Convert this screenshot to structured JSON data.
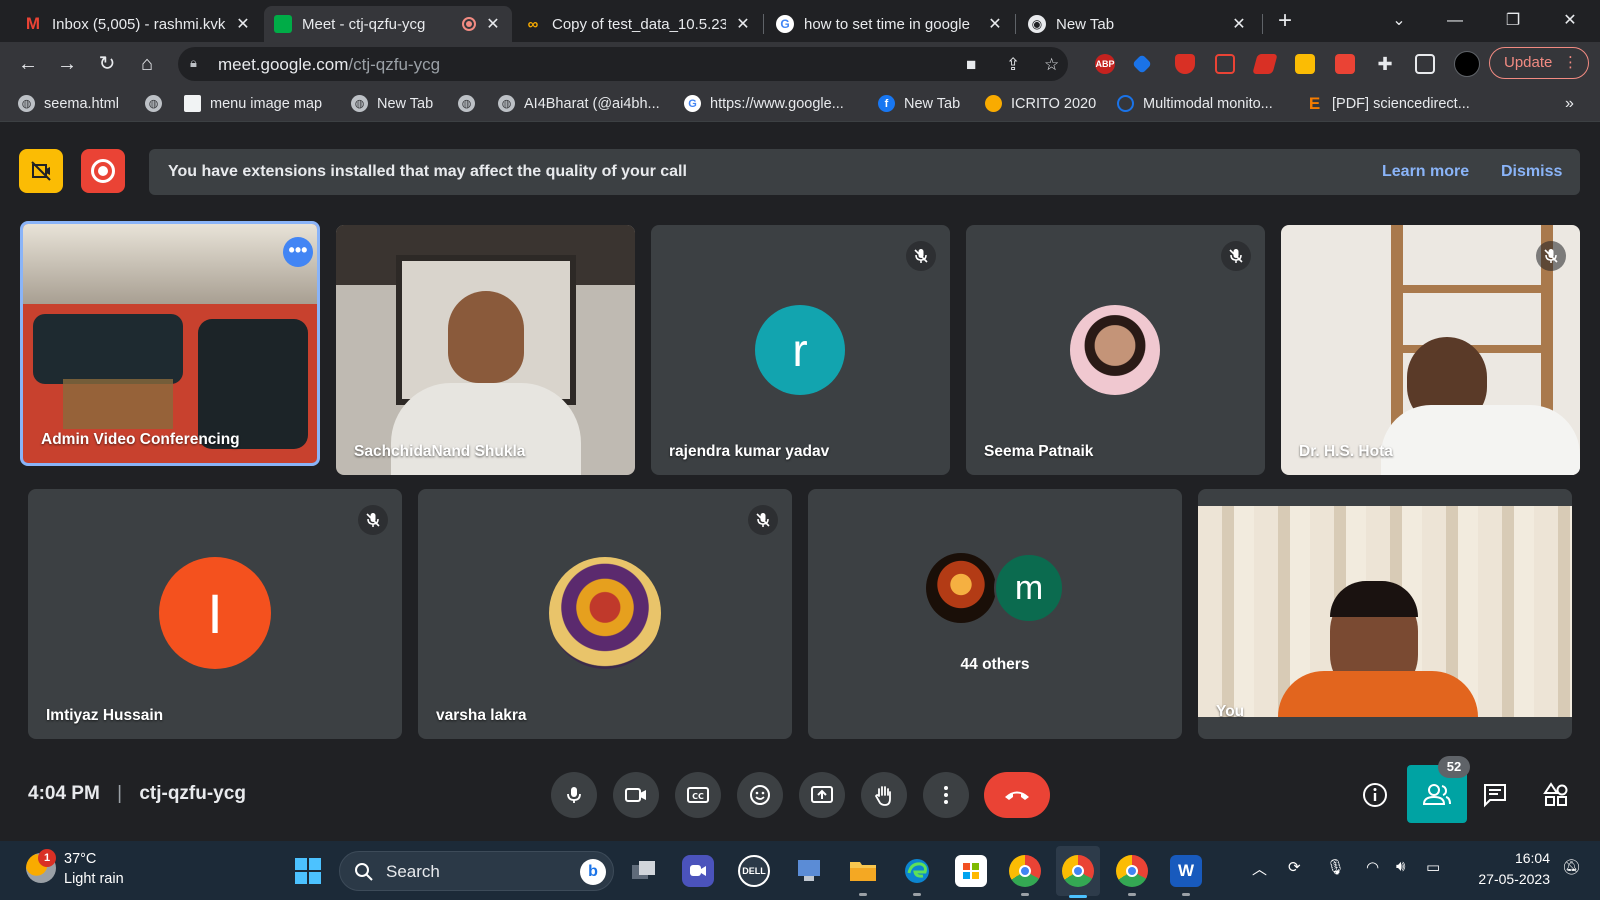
{
  "tabs": [
    {
      "title": "Inbox (5,005) - rashmi.kvk",
      "favicon": "gmail-icon",
      "color": "#ea4335"
    },
    {
      "title": "Meet - ctj-qzfu-ycg",
      "favicon": "meet-icon",
      "color": "#00ac47",
      "active": true
    },
    {
      "title": "Copy of test_data_10.5.23",
      "favicon": "colab-icon",
      "color": "#f9ab00"
    },
    {
      "title": "how to set time in google",
      "favicon": "google-icon",
      "color": "#4285f4"
    },
    {
      "title": "New Tab",
      "favicon": "chrome-icon",
      "color": "#e8eaed"
    }
  ],
  "toolbar": {
    "url_host": "meet.google.com",
    "url_path": "/ctj-qzfu-ycg",
    "update_label": "Update",
    "ext_abp": "ABP"
  },
  "bookmarks": [
    {
      "label": "seema.html"
    },
    {
      "label": ""
    },
    {
      "label": "menu image map"
    },
    {
      "label": "New Tab"
    },
    {
      "label": ""
    },
    {
      "label": "AI4Bharat (@ai4bh..."
    },
    {
      "label": "https://www.google..."
    },
    {
      "label": "New Tab"
    },
    {
      "label": "ICRITO 2020"
    },
    {
      "label": "Multimodal monito..."
    },
    {
      "label": "[PDF] sciencedirect..."
    }
  ],
  "banner": {
    "message": "You have extensions installed that may affect the quality of your call",
    "learn_more": "Learn more",
    "dismiss": "Dismiss"
  },
  "participants": [
    {
      "name": "Admin Video Conferencing"
    },
    {
      "name": "SachchidaNand Shukla"
    },
    {
      "name": "rajendra kumar yadav",
      "initial": "r",
      "color": "#12a4af"
    },
    {
      "name": "Seema Patnaik"
    },
    {
      "name": "Dr. H.S. Hota"
    },
    {
      "name": "Imtiyaz Hussain",
      "initial": "I",
      "color": "#f4511e"
    },
    {
      "name": "varsha lakra"
    },
    {
      "name": "",
      "initial": "m",
      "color": "#0b6b4f",
      "others": "44 others"
    },
    {
      "name": "You"
    }
  ],
  "meeting": {
    "time": "4:04 PM",
    "separator": "|",
    "code": "ctj-qzfu-ycg",
    "people_count": "52"
  },
  "taskbar": {
    "temperature": "37°C",
    "weather": "Light rain",
    "weather_badge": "1",
    "search_placeholder": "Search",
    "clock_time": "16:04",
    "clock_date": "27-05-2023",
    "dell_label": "DELL",
    "word_label": "W"
  },
  "colors": {
    "accent_blue": "#8ab4f8",
    "end_call_red": "#ea4335",
    "people_active": "#00a3a3"
  }
}
